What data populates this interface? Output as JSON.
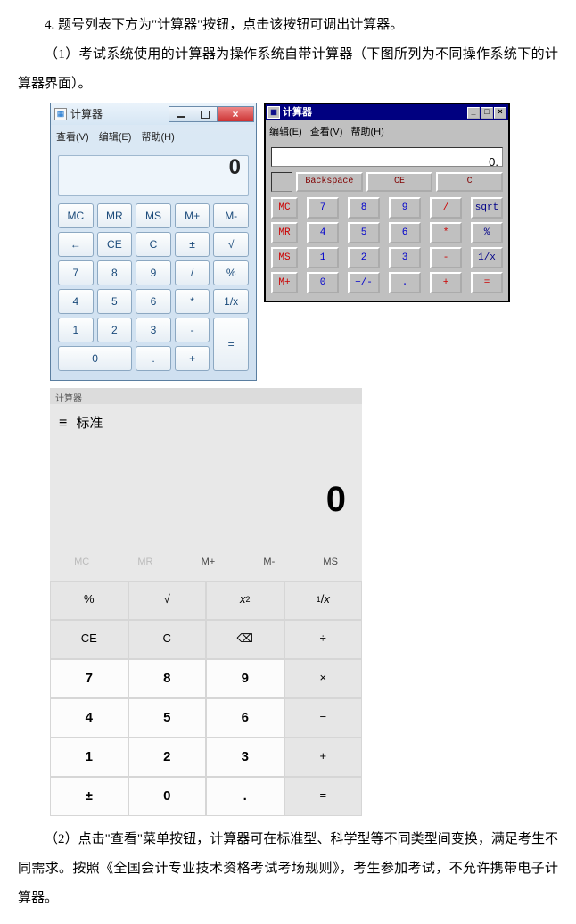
{
  "text": {
    "p1": "4. 题号列表下方为\"计算器\"按钮，点击该按钮可调出计算器。",
    "p2": "（1）考试系统使用的计算器为操作系统自带计算器（下图所列为不同操作系统下的计算器界面）。",
    "p3": "（2）点击\"查看\"菜单按钮，计算器可在标准型、科学型等不同类型间变换，满足考生不同需求。按照《全国会计专业技术资格考试考场规则》，考生参加考试，不允许携带电子计算器。"
  },
  "calc1": {
    "title": "计算器",
    "menu": {
      "view": "查看(V)",
      "edit": "编辑(E)",
      "help": "帮助(H)"
    },
    "display": "0",
    "winbtn_close": "×",
    "buttons": [
      "MC",
      "MR",
      "MS",
      "M+",
      "M-",
      "←",
      "CE",
      "C",
      "±",
      "√",
      "7",
      "8",
      "9",
      "/",
      "%",
      "4",
      "5",
      "6",
      "*",
      "1/x",
      "1",
      "2",
      "3",
      "-",
      "=",
      "0",
      ".",
      "+"
    ]
  },
  "calc2": {
    "title": "计算器",
    "menu": {
      "edit": "编辑(E)",
      "view": "查看(V)",
      "help": "帮助(H)"
    },
    "display": "0.",
    "winbtn_min": "_",
    "winbtn_max": "□",
    "winbtn_close": "×",
    "topbtns": [
      "Backspace",
      "CE",
      "C"
    ],
    "grid": [
      [
        "MC",
        "7",
        "8",
        "9",
        "/",
        "sqrt"
      ],
      [
        "MR",
        "4",
        "5",
        "6",
        "*",
        "%"
      ],
      [
        "MS",
        "1",
        "2",
        "3",
        "-",
        "1/x"
      ],
      [
        "M+",
        "0",
        "+/-",
        ".",
        "+",
        "="
      ]
    ]
  },
  "calc3": {
    "title": "计算器",
    "mode": "标准",
    "menuicon": "≡",
    "display": "0",
    "mem": [
      "MC",
      "MR",
      "M+",
      "M-",
      "MS"
    ],
    "grid": [
      [
        "%",
        "√",
        "x²",
        "¹/x"
      ],
      [
        "CE",
        "C",
        "⌫",
        "÷"
      ],
      [
        "7",
        "8",
        "9",
        "×"
      ],
      [
        "4",
        "5",
        "6",
        "−"
      ],
      [
        "1",
        "2",
        "3",
        "+"
      ],
      [
        "±",
        "0",
        ".",
        "="
      ]
    ]
  }
}
